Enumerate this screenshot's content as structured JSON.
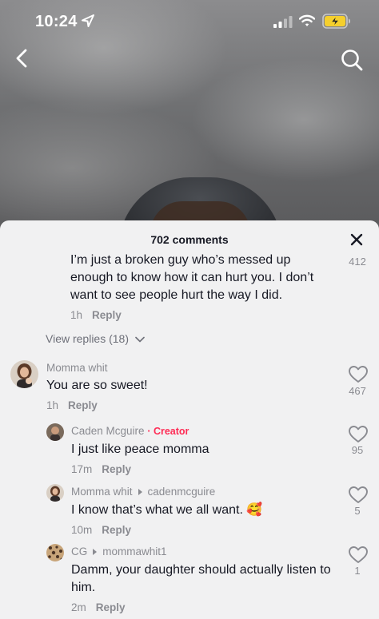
{
  "status_bar": {
    "time": "10:24"
  },
  "comments_panel": {
    "title": "702 comments",
    "top_comment": {
      "text": "I’m just a broken guy who’s messed up enough to know how it can hurt you. I don’t want to see people hurt the way I did.",
      "age": "1h",
      "reply_label": "Reply",
      "likes": "412"
    },
    "view_replies": "View replies (18)",
    "comment": {
      "author": "Momma whit",
      "text": "You are so sweet!",
      "age": "1h",
      "reply_label": "Reply",
      "likes": "467"
    },
    "replies": [
      {
        "author": "Caden Mcguire",
        "creator_tag": "· Creator",
        "reply_to": "",
        "text": "I just like peace momma",
        "age": "17m",
        "reply_label": "Reply",
        "likes": "95"
      },
      {
        "author": "Momma whit",
        "creator_tag": "",
        "reply_to": "cadenmcguire",
        "text": "I know that’s what we all want. 🥰",
        "age": "10m",
        "reply_label": "Reply",
        "likes": "5"
      },
      {
        "author": "CG",
        "creator_tag": "",
        "reply_to": "mommawhit1",
        "text": "Damm, your daughter should actually listen to him.",
        "age": "2m",
        "reply_label": "Reply",
        "likes": "1"
      }
    ]
  },
  "colors": {
    "creator_accent": "#fe2c55",
    "sheet_bg": "#f1f1f2",
    "text_primary": "#161823",
    "text_secondary": "#8a8b91"
  }
}
